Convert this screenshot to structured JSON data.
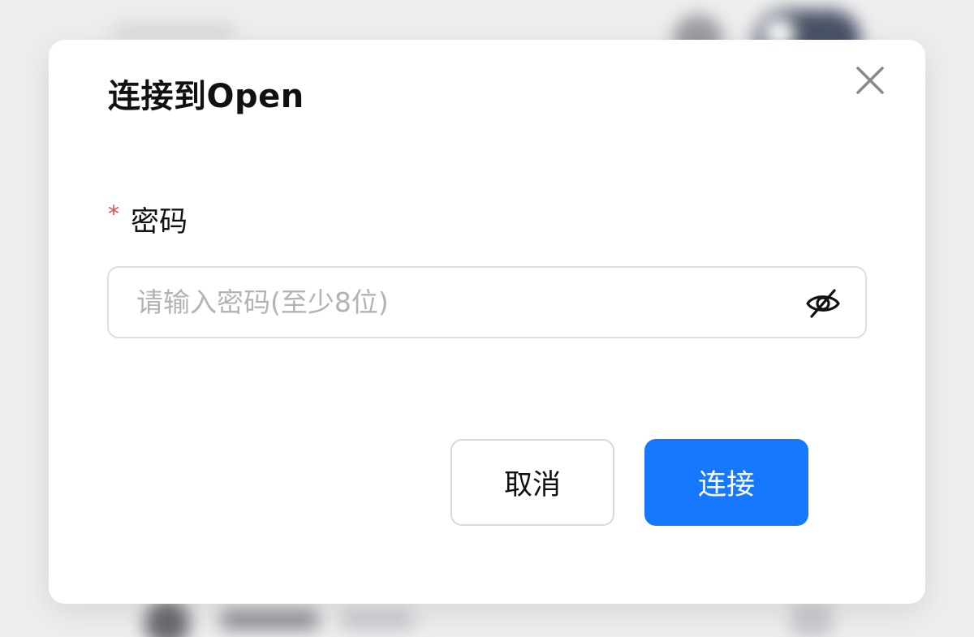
{
  "dialog": {
    "title": "连接到Open",
    "close_icon": "close-icon"
  },
  "password_field": {
    "required_mark": "*",
    "label": "密码",
    "placeholder": "请输入密码(至少8位)",
    "value": "",
    "toggle_icon": "eye-off-icon"
  },
  "actions": {
    "cancel_label": "取消",
    "connect_label": "连接"
  },
  "colors": {
    "primary": "#1677ff",
    "required": "#e5484d",
    "input_border": "#dedede",
    "placeholder": "#b3b3b3"
  }
}
